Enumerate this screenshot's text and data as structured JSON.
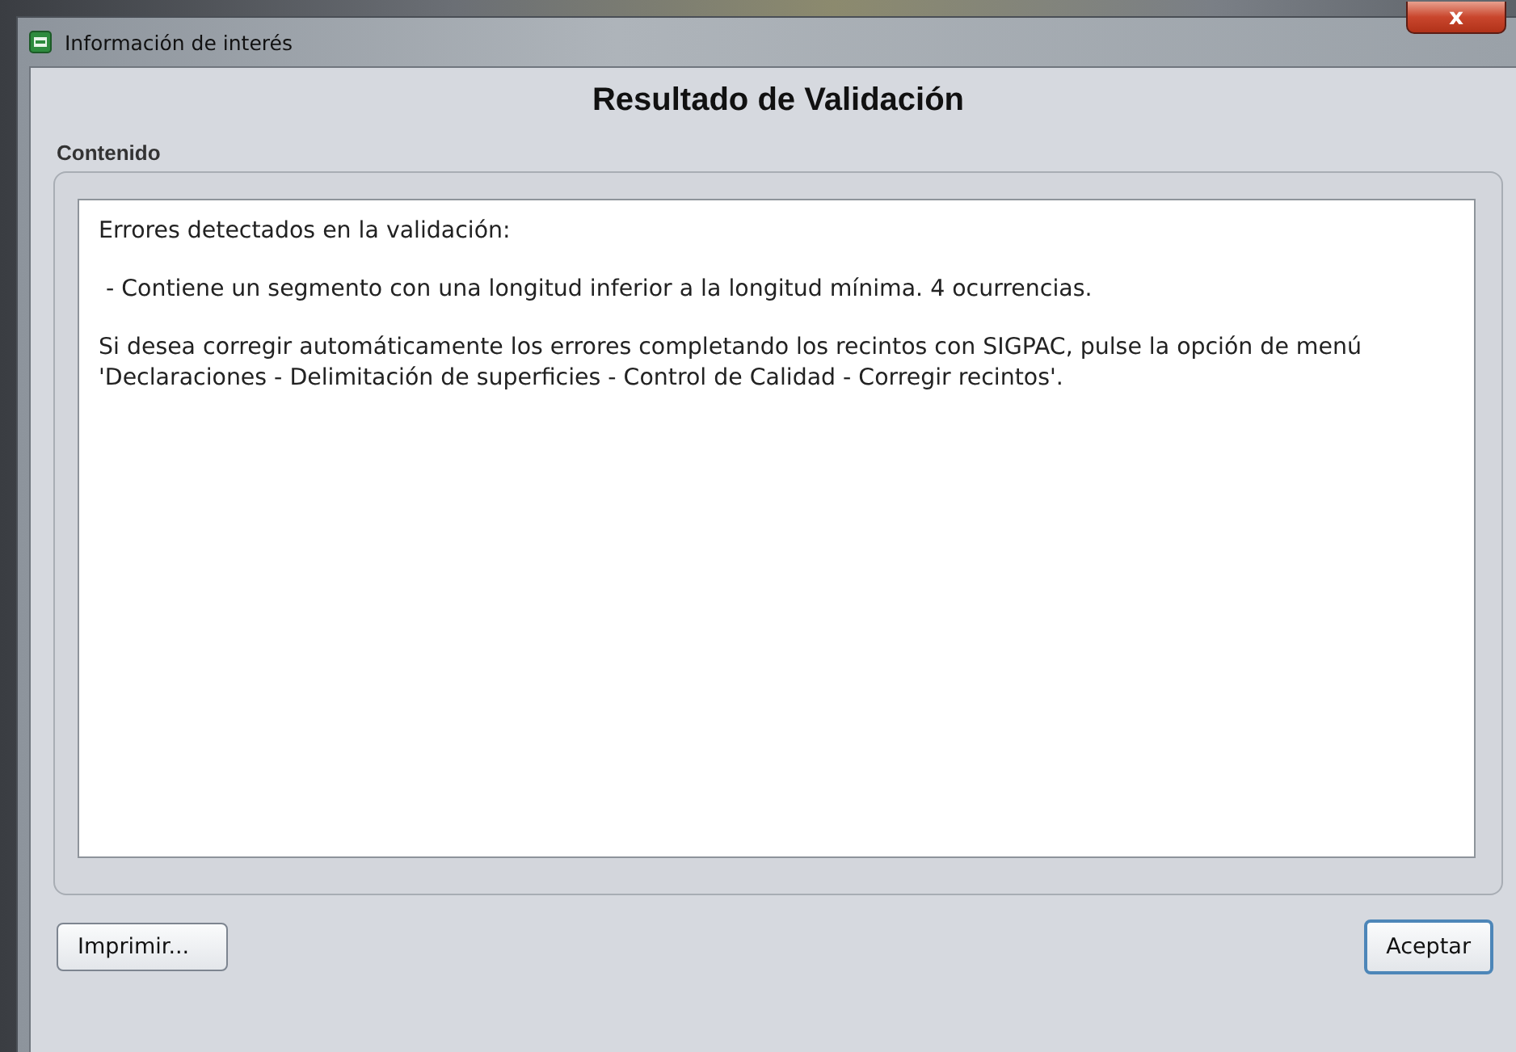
{
  "window": {
    "title": "Información de interés",
    "close": "x"
  },
  "heading": "Resultado de Validación",
  "group": {
    "label": "Contenido",
    "paragraphs": [
      "Errores detectados en la validación:",
      " - Contiene un segmento con una longitud inferior a la longitud mínima. 4 ocurrencias.",
      "Si desea corregir automáticamente los errores completando los recintos con SIGPAC, pulse la opción de menú 'Declaraciones - Delimitación de superficies - Control de Calidad - Corregir recintos'."
    ]
  },
  "buttons": [
    {
      "label": "Imprimir...",
      "kind": "secondary"
    },
    {
      "label": "Aceptar",
      "kind": "default"
    }
  ]
}
